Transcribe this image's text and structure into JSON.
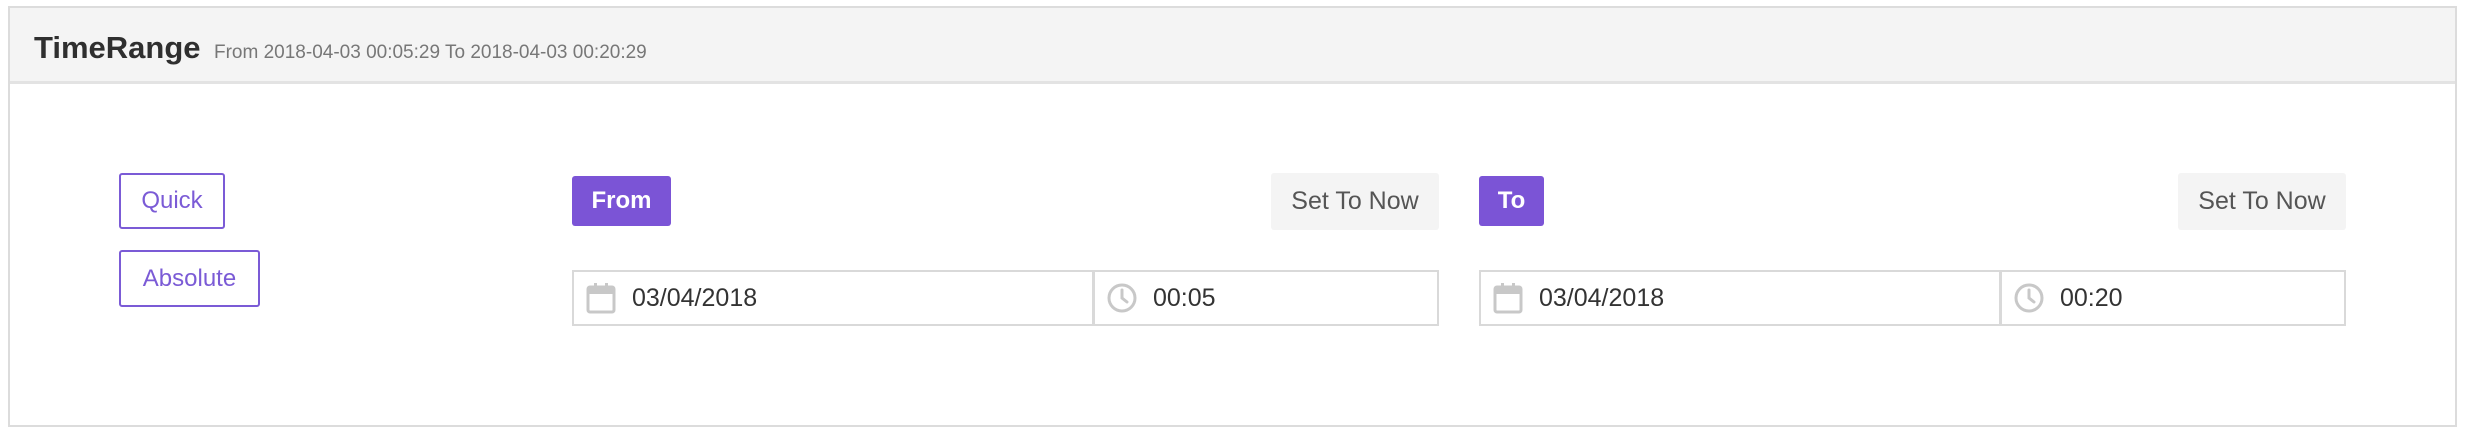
{
  "header": {
    "title": "TimeRange",
    "subtitle": "From 2018-04-03 00:05:29 To 2018-04-03 00:20:29"
  },
  "modes": {
    "quick": "Quick",
    "absolute": "Absolute"
  },
  "from": {
    "tag": "From",
    "set_now": "Set To Now",
    "date": "03/04/2018",
    "time": "00:05"
  },
  "to": {
    "tag": "To",
    "set_now": "Set To Now",
    "date": "03/04/2018",
    "time": "00:20"
  },
  "icons": {
    "date": "calendar-icon",
    "time": "clock-icon"
  },
  "colors": {
    "accent": "#7b54d6",
    "header_bg": "#f4f4f4",
    "border": "#d9d9d9",
    "icon": "#c8c8c8"
  }
}
